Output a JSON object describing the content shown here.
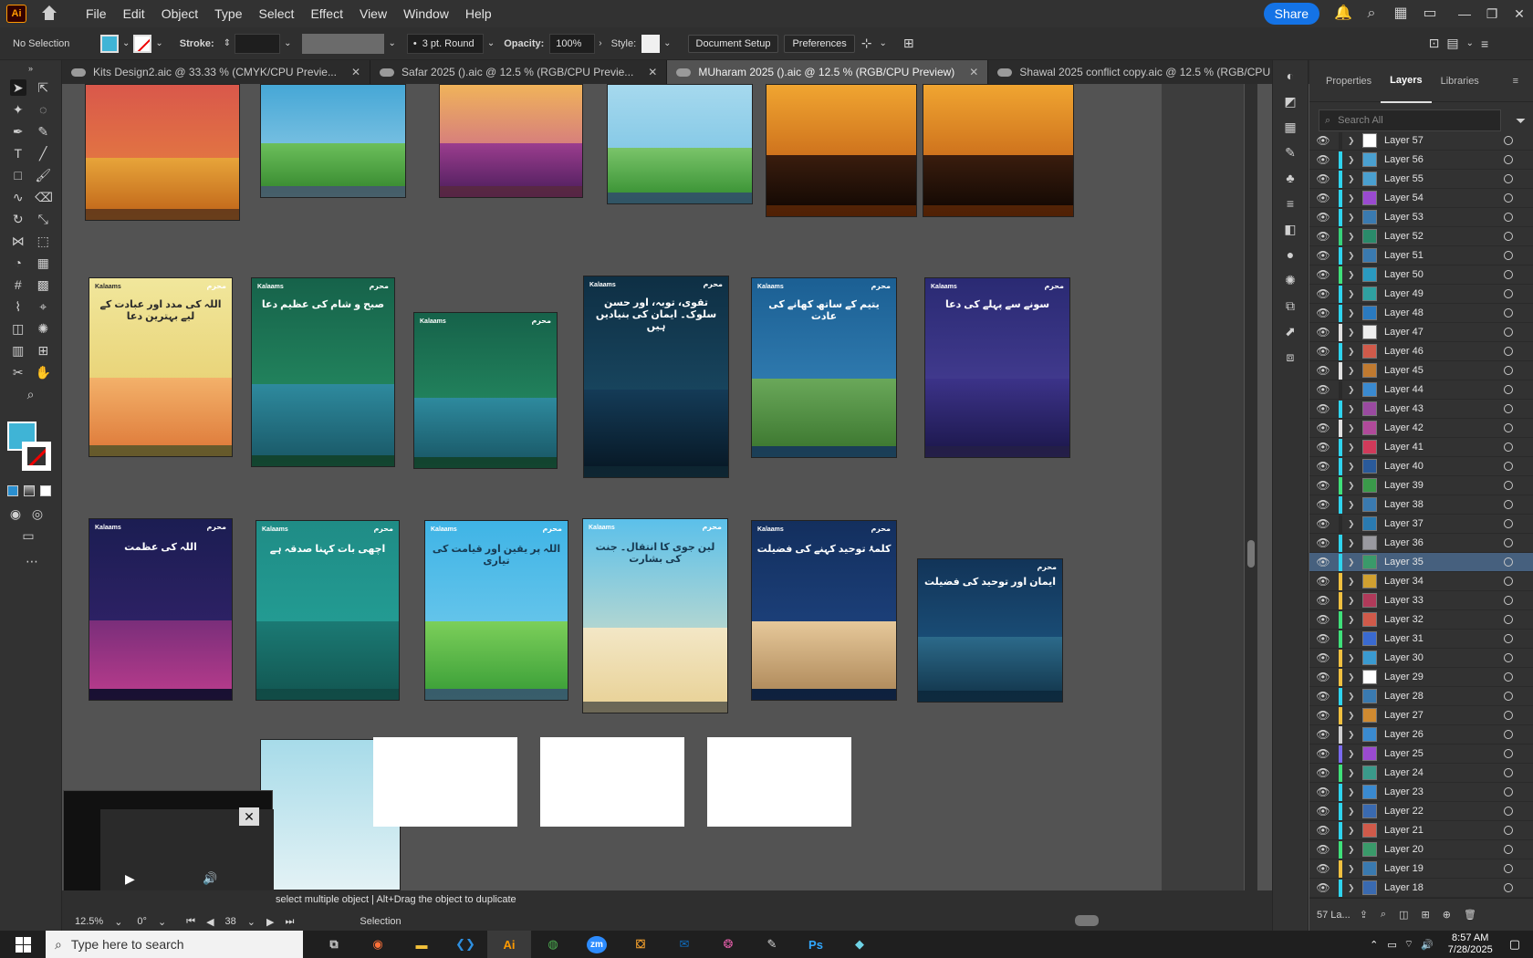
{
  "app": {
    "logo": "Ai"
  },
  "menu": [
    "File",
    "Edit",
    "Object",
    "Type",
    "Select",
    "Effect",
    "View",
    "Window",
    "Help"
  ],
  "menubar_right": {
    "share": "Share"
  },
  "control": {
    "selection": "No Selection",
    "stroke_label": "Stroke:",
    "brush": "3 pt. Round",
    "opacity_label": "Opacity:",
    "opacity_value": "100%",
    "style_label": "Style:",
    "document_setup": "Document Setup",
    "preferences": "Preferences"
  },
  "tabs": [
    {
      "label": "Kits Design2.aic @ 33.33 % (CMYK/CPU Previe...",
      "active": false
    },
    {
      "label": "Safar 2025 ().aic @ 12.5 % (RGB/CPU Previe...",
      "active": false
    },
    {
      "label": "MUharam 2025 ().aic @ 12.5 % (RGB/CPU Preview)",
      "active": true
    },
    {
      "label": "Shawal 2025 conflict copy.aic @ 12.5 % (RGB/CPU Previ...",
      "active": false
    }
  ],
  "posters": {
    "row2": [
      "اللہ کی مدد اور عبادت کے لیے بہترین دعا",
      "صبح و شام کی عظیم دعا",
      "",
      "تقوی، توبہ، اور حسن سلوک۔ ایمان کی بنیادیں ہیں",
      "یتیم کے ساتھ کھانے کی عادت",
      "سونے سے پہلے کی دعا"
    ],
    "row3": [
      "اللہ کی عظمت",
      "اچھی بات کہنا صدقہ ہے",
      "اللہ پر یقین اور قیامت کی تیاری",
      "لین جوی کا انتقال۔ جنت کی بشارت",
      "کلمۂ توحید کہنے کی فضیلت",
      "ایمان اور توحید کی فضیلت"
    ],
    "brand_left": "Kalaams",
    "brand_right": "محرم"
  },
  "status": {
    "hint": "select multiple object  |  Alt+Drag the object to duplicate",
    "zoom": "12.5%",
    "rotation": "0°",
    "artboard": "38",
    "tool": "Selection"
  },
  "panel": {
    "tabs": [
      "Properties",
      "Layers",
      "Libraries"
    ],
    "active_tab": "Layers",
    "search_placeholder": "Search All",
    "layers": [
      "Layer 57",
      "Layer 56",
      "Layer 55",
      "Layer 54",
      "Layer 53",
      "Layer 52",
      "Layer 51",
      "Layer 50",
      "Layer 49",
      "Layer 48",
      "Layer 47",
      "Layer 46",
      "Layer 45",
      "Layer 44",
      "Layer 43",
      "Layer 42",
      "Layer 41",
      "Layer 40",
      "Layer 39",
      "Layer 38",
      "Layer 37",
      "Layer 36",
      "Layer 35",
      "Layer 34",
      "Layer 33",
      "Layer 32",
      "Layer 31",
      "Layer 30",
      "Layer 29",
      "Layer 28",
      "Layer 27",
      "Layer 26",
      "Layer 25",
      "Layer 24",
      "Layer 23",
      "Layer 22",
      "Layer 21",
      "Layer 20",
      "Layer 19",
      "Layer 18"
    ],
    "selected_layer": "Layer 35",
    "layer_count": "57 La..."
  },
  "taskbar": {
    "search": "Type here to search",
    "icons": [
      "Firefox",
      "File Explorer",
      "VS Code",
      "Ai",
      "Chrome",
      "zm",
      "Store",
      "Outlook",
      "Photos",
      "Tool",
      "Ps",
      "App"
    ],
    "time": "8:57 AM",
    "date": "7/28/2025"
  }
}
